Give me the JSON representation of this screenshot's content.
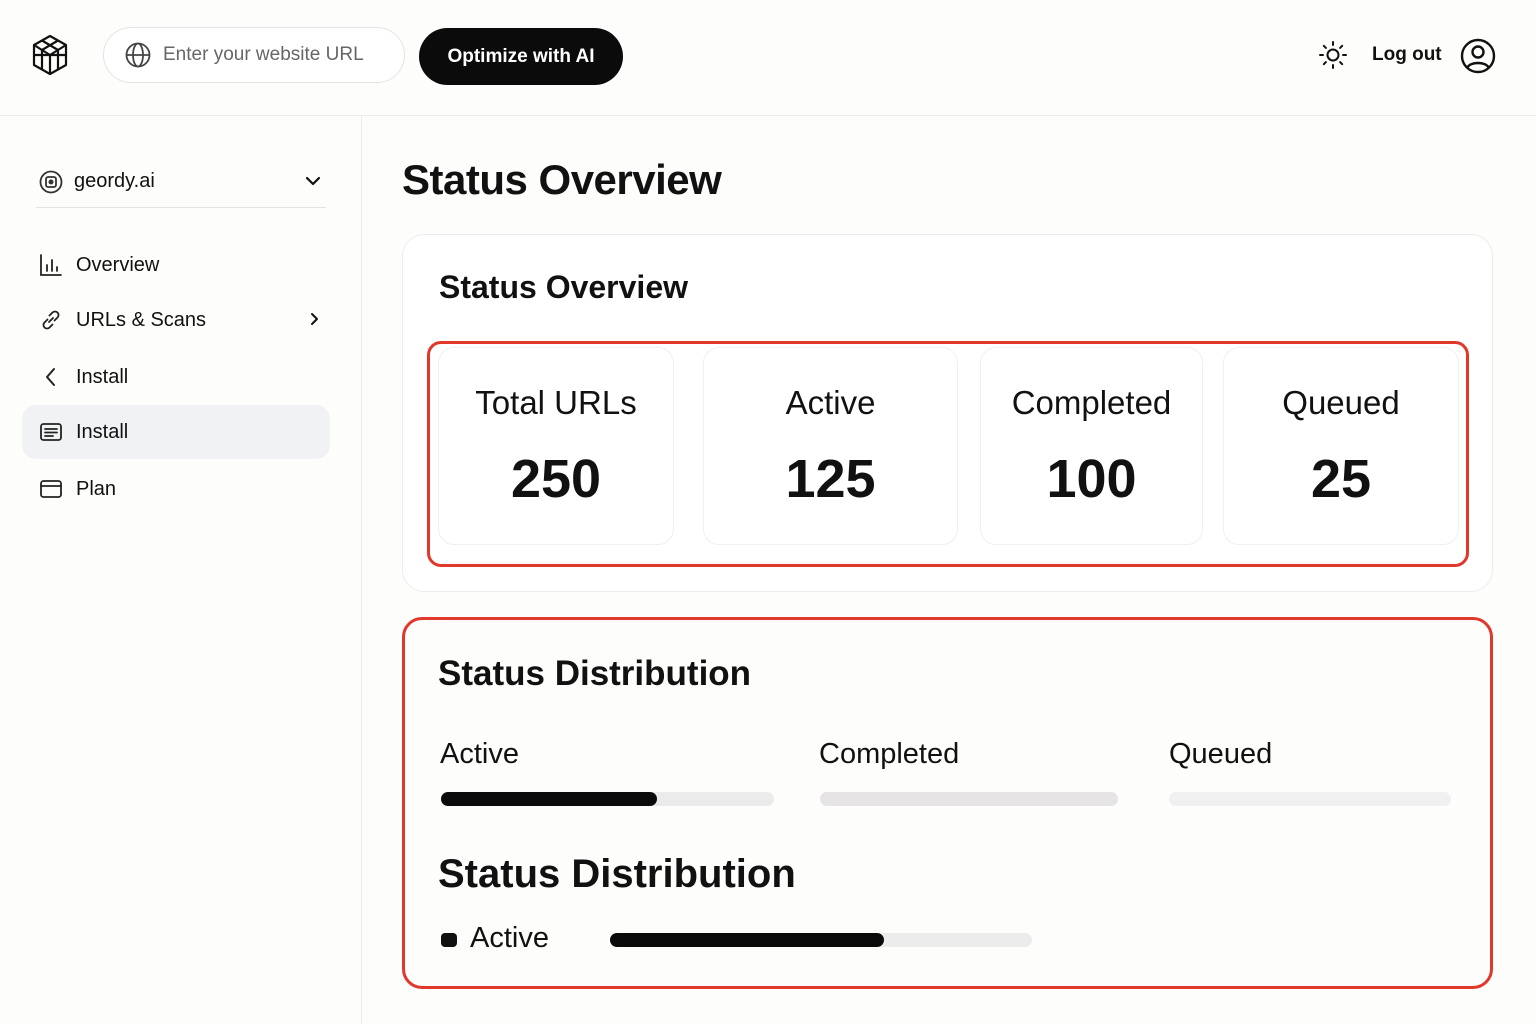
{
  "header": {
    "url_placeholder": "Enter your website URL",
    "optimize_label": "Optimize with AI",
    "logout_label": "Log out",
    "icons": [
      "logo-icon",
      "globe-icon",
      "sun-icon",
      "user-circle-icon"
    ]
  },
  "sidebar": {
    "site_name": "geordy.ai",
    "items": [
      {
        "label": "Overview",
        "icon": "bar-chart-icon"
      },
      {
        "label": "URLs & Scans",
        "icon": "link-icon"
      },
      {
        "label": "Install",
        "icon": "chevron-left-icon"
      },
      {
        "label": "Install",
        "icon": "list-icon"
      },
      {
        "label": "Plan",
        "icon": "card-icon"
      }
    ]
  },
  "main": {
    "page_title": "Status Overview",
    "card_title": "Status Overview",
    "stats": [
      {
        "label": "Total URLs",
        "value": "250"
      },
      {
        "label": "Active",
        "value": "125"
      },
      {
        "label": "Completed",
        "value": "100"
      },
      {
        "label": "Queued",
        "value": "25"
      }
    ],
    "distribution": {
      "title": "Status Distribution",
      "items": [
        {
          "label": "Active",
          "progress": 0.65
        },
        {
          "label": "Completed",
          "progress": 0
        },
        {
          "label": "Queued",
          "progress": 0
        }
      ],
      "title_2": "Status Distribution",
      "legend": {
        "label": "Active",
        "progress": 0.65
      }
    }
  },
  "colors": {
    "accent": "#0b0b0b",
    "highlight": "#e0392b",
    "background": "#fdfdfb",
    "active_nav": "#f1f2f3"
  }
}
